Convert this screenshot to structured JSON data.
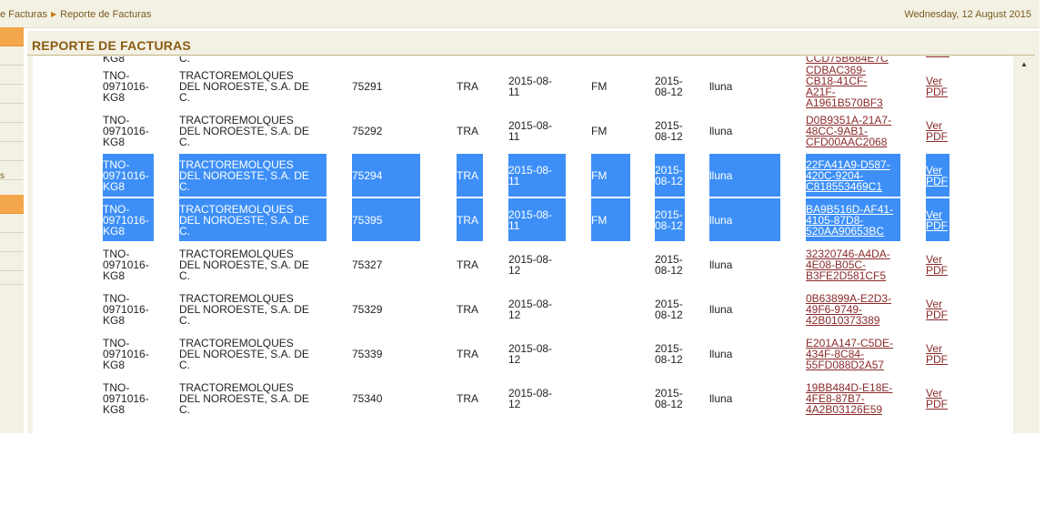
{
  "breadcrumb": {
    "part1": "e Facturas",
    "part2": "Reporte de Facturas"
  },
  "date": "Wednesday, 12 August 2015",
  "panel_title": "REPORTE DE FACTURAS",
  "menu_fragment": "s",
  "top_partial_row": {
    "rfc": "KG8",
    "name": "C.",
    "uuid": "CCD75B684E7C"
  },
  "rows": [
    {
      "rfc": [
        "TNO-",
        "0971016-",
        "KG8"
      ],
      "name": [
        "TRACTOREMOLQUES",
        "DEL NOROESTE, S.A. DE",
        "C."
      ],
      "folio": "75291",
      "serie": "TRA",
      "fecha": [
        "2015-08-",
        "11"
      ],
      "tipo": "FM",
      "fpago": [
        "2015-",
        "08-12"
      ],
      "user": "lluna",
      "uuid": [
        "CDBAC369-",
        "CB18-41CF-",
        "A21F-",
        "A1961B570BF3"
      ],
      "pdf": [
        "Ver",
        "PDF"
      ],
      "selected": false
    },
    {
      "rfc": [
        "TNO-",
        "0971016-",
        "KG8"
      ],
      "name": [
        "TRACTOREMOLQUES",
        "DEL NOROESTE, S.A. DE",
        "C."
      ],
      "folio": "75292",
      "serie": "TRA",
      "fecha": [
        "2015-08-",
        "11"
      ],
      "tipo": "FM",
      "fpago": [
        "2015-",
        "08-12"
      ],
      "user": "lluna",
      "uuid": [
        "D0B9351A-21A7-",
        "48CC-9AB1-",
        "CFD00AAC2068"
      ],
      "pdf": [
        "Ver",
        "PDF"
      ],
      "selected": false
    },
    {
      "rfc": [
        "TNO-",
        "0971016-",
        "KG8"
      ],
      "name": [
        "TRACTOREMOLQUES",
        "DEL NOROESTE, S.A. DE",
        "C."
      ],
      "folio": "75294",
      "serie": "TRA",
      "fecha": [
        "2015-08-",
        "11"
      ],
      "tipo": "FM",
      "fpago": [
        "2015-",
        "08-12"
      ],
      "user": "lluna",
      "uuid": [
        "22FA41A9-D587-",
        "420C-9204-",
        "C818553469C1"
      ],
      "pdf": [
        "Ver",
        "PDF"
      ],
      "selected": true
    },
    {
      "rfc": [
        "TNO-",
        "0971016-",
        "KG8"
      ],
      "name": [
        "TRACTOREMOLQUES",
        "DEL NOROESTE, S.A. DE",
        "C."
      ],
      "folio": "75395",
      "serie": "TRA",
      "fecha": [
        "2015-08-",
        "11"
      ],
      "tipo": "FM",
      "fpago": [
        "2015-",
        "08-12"
      ],
      "user": "lluna",
      "uuid": [
        "BA9B516D-AF41-",
        "4105-87D8-",
        "520AA90653BC"
      ],
      "pdf": [
        "Ver",
        "PDF"
      ],
      "selected": true
    },
    {
      "rfc": [
        "TNO-",
        "0971016-",
        "KG8"
      ],
      "name": [
        "TRACTOREMOLQUES",
        "DEL NOROESTE, S.A. DE",
        "C."
      ],
      "folio": "75327",
      "serie": "TRA",
      "fecha": [
        "2015-08-",
        "12"
      ],
      "tipo": "",
      "fpago": [
        "2015-",
        "08-12"
      ],
      "user": "lluna",
      "uuid": [
        "32320746-A4DA-",
        "4E08-B05C-",
        "B3FE2D581CF5"
      ],
      "pdf": [
        "Ver",
        "PDF"
      ],
      "selected": false
    },
    {
      "rfc": [
        "TNO-",
        "0971016-",
        "KG8"
      ],
      "name": [
        "TRACTOREMOLQUES",
        "DEL NOROESTE, S.A. DE",
        "C."
      ],
      "folio": "75329",
      "serie": "TRA",
      "fecha": [
        "2015-08-",
        "12"
      ],
      "tipo": "",
      "fpago": [
        "2015-",
        "08-12"
      ],
      "user": "lluna",
      "uuid": [
        "0B63899A-E2D3-",
        "49F6-9749-",
        "42B010373389"
      ],
      "pdf": [
        "Ver",
        "PDF"
      ],
      "selected": false
    },
    {
      "rfc": [
        "TNO-",
        "0971016-",
        "KG8"
      ],
      "name": [
        "TRACTOREMOLQUES",
        "DEL NOROESTE, S.A. DE",
        "C."
      ],
      "folio": "75339",
      "serie": "TRA",
      "fecha": [
        "2015-08-",
        "12"
      ],
      "tipo": "",
      "fpago": [
        "2015-",
        "08-12"
      ],
      "user": "lluna",
      "uuid": [
        "E201A147-C5DE-",
        "434F-8C84-",
        "55FD088D2A57"
      ],
      "pdf": [
        "Ver",
        "PDF"
      ],
      "selected": false
    },
    {
      "rfc": [
        "TNO-",
        "0971016-",
        "KG8"
      ],
      "name": [
        "TRACTOREMOLQUES",
        "DEL NOROESTE, S.A. DE",
        "C."
      ],
      "folio": "75340",
      "serie": "TRA",
      "fecha": [
        "2015-08-",
        "12"
      ],
      "tipo": "",
      "fpago": [
        "2015-",
        "08-12"
      ],
      "user": "lluna",
      "uuid": [
        "19BB484D-E18E-",
        "4FE8-87B7-",
        "4A2B03126E59"
      ],
      "pdf": [
        "Ver",
        "PDF"
      ],
      "selected": false
    }
  ]
}
